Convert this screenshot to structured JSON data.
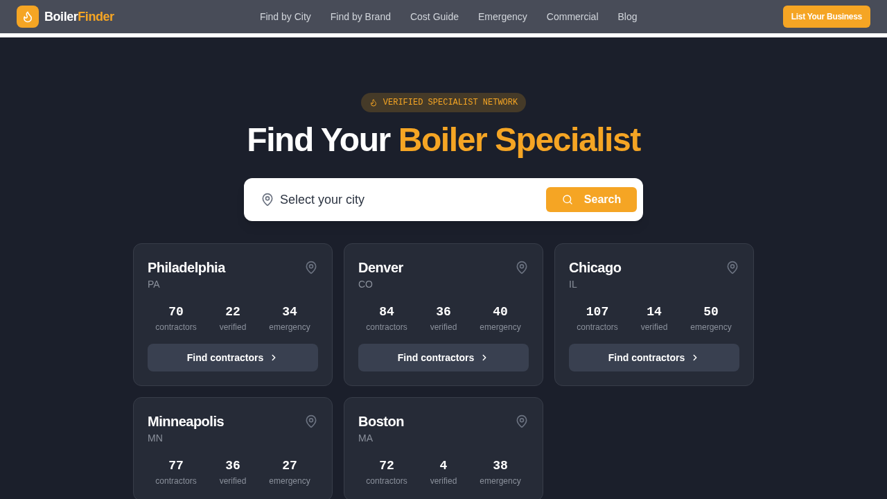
{
  "header": {
    "logo": {
      "text": "Boiler",
      "accent_text": "Finder"
    },
    "nav": [
      "Find by City",
      "Find by Brand",
      "Cost Guide",
      "Emergency",
      "Commercial",
      "Blog"
    ],
    "cta": "List Your Business"
  },
  "hero": {
    "badge": "VERIFIED SPECIALIST NETWORK",
    "heading": {
      "text": "Find Your",
      "accent_text": "Boiler Specialist"
    },
    "search": {
      "placeholder": "Select your city",
      "button": "Search"
    }
  },
  "cities": [
    {
      "name": "Philadelphia",
      "state": "PA",
      "stats": [
        {
          "value": "70",
          "label": "contractors"
        },
        {
          "value": "22",
          "label": "verified"
        },
        {
          "value": "34",
          "label": "emergency"
        }
      ],
      "button": "Find contractors"
    },
    {
      "name": "Denver",
      "state": "CO",
      "stats": [
        {
          "value": "84",
          "label": "contractors"
        },
        {
          "value": "36",
          "label": "verified"
        },
        {
          "value": "40",
          "label": "emergency"
        }
      ],
      "button": "Find contractors"
    },
    {
      "name": "Chicago",
      "state": "IL",
      "stats": [
        {
          "value": "107",
          "label": "contractors"
        },
        {
          "value": "14",
          "label": "verified"
        },
        {
          "value": "50",
          "label": "emergency"
        }
      ],
      "button": "Find contractors"
    },
    {
      "name": "Minneapolis",
      "state": "MN",
      "stats": [
        {
          "value": "77",
          "label": "contractors"
        },
        {
          "value": "36",
          "label": "verified"
        },
        {
          "value": "27",
          "label": "emergency"
        }
      ]
    },
    {
      "name": "Boston",
      "state": "MA",
      "stats": [
        {
          "value": "72",
          "label": "contractors"
        },
        {
          "value": "4",
          "label": "verified"
        },
        {
          "value": "38",
          "label": "emergency"
        }
      ]
    }
  ]
}
